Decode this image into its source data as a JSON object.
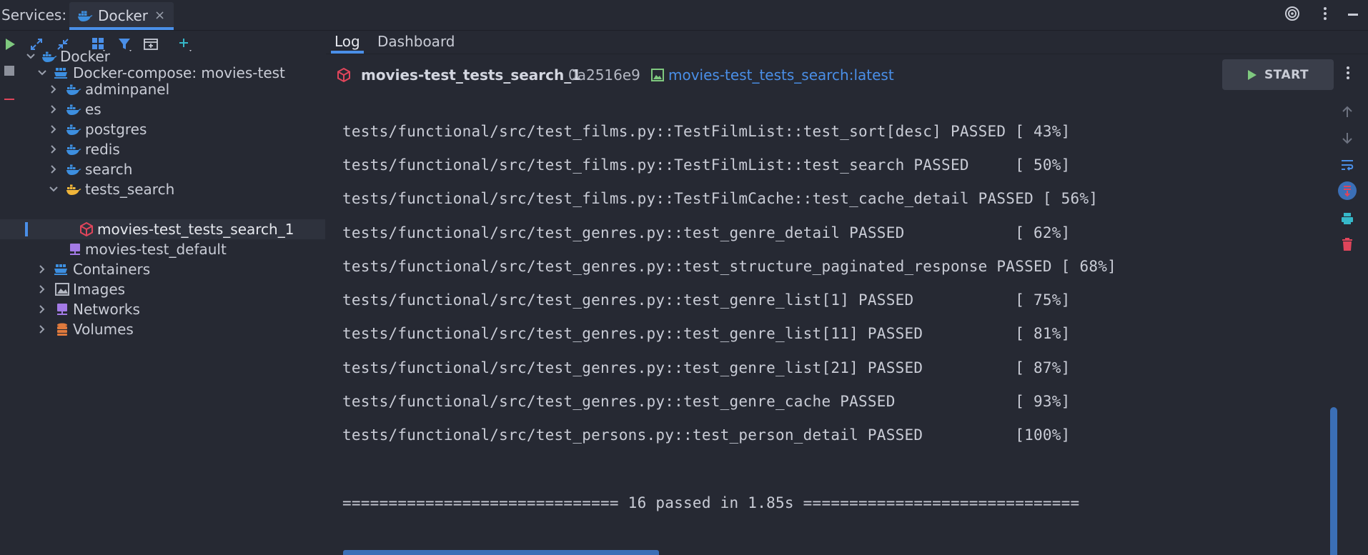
{
  "topbar": {
    "services_label": "Services:",
    "tab": {
      "label": "Docker",
      "close": "×"
    }
  },
  "tree": {
    "root": "Docker",
    "compose": "Docker-compose: movies-test",
    "services": [
      "adminpanel",
      "es",
      "postgres",
      "redis",
      "search"
    ],
    "tests_search": "tests_search",
    "container": "movies-test_tests_search_1",
    "network": "movies-test_default",
    "groups": [
      "Containers",
      "Images",
      "Networks",
      "Volumes"
    ]
  },
  "tabs": {
    "log": "Log",
    "dashboard": "Dashboard"
  },
  "container": {
    "name": "movies-test_tests_search_1",
    "id": "0a2516e9",
    "image": "movies-test_tests_search:latest",
    "start_label": "START"
  },
  "log": {
    "lines": [
      "tests/functional/src/test_films.py::TestFilmList::test_sort[desc] PASSED [ 43%]",
      "tests/functional/src/test_films.py::TestFilmList::test_search PASSED     [ 50%]",
      "tests/functional/src/test_films.py::TestFilmCache::test_cache_detail PASSED [ 56%]",
      "tests/functional/src/test_genres.py::test_genre_detail PASSED            [ 62%]",
      "tests/functional/src/test_genres.py::test_structure_paginated_response PASSED [ 68%]",
      "tests/functional/src/test_genres.py::test_genre_list[1] PASSED           [ 75%]",
      "tests/functional/src/test_genres.py::test_genre_list[11] PASSED          [ 81%]",
      "tests/functional/src/test_genres.py::test_genre_list[21] PASSED          [ 87%]",
      "tests/functional/src/test_genres.py::test_genre_cache PASSED             [ 93%]",
      "tests/functional/src/test_persons.py::test_person_detail PASSED          [100%]"
    ],
    "summary": "============================== 16 passed in 1.85s =============================="
  },
  "colors": {
    "accent": "#4a8fe8",
    "docker_blue": "#3d8fe0",
    "container_red": "#e0455b",
    "network_purple": "#a37ae6",
    "volume_orange": "#e07a3d",
    "start_green": "#7fc97f"
  }
}
